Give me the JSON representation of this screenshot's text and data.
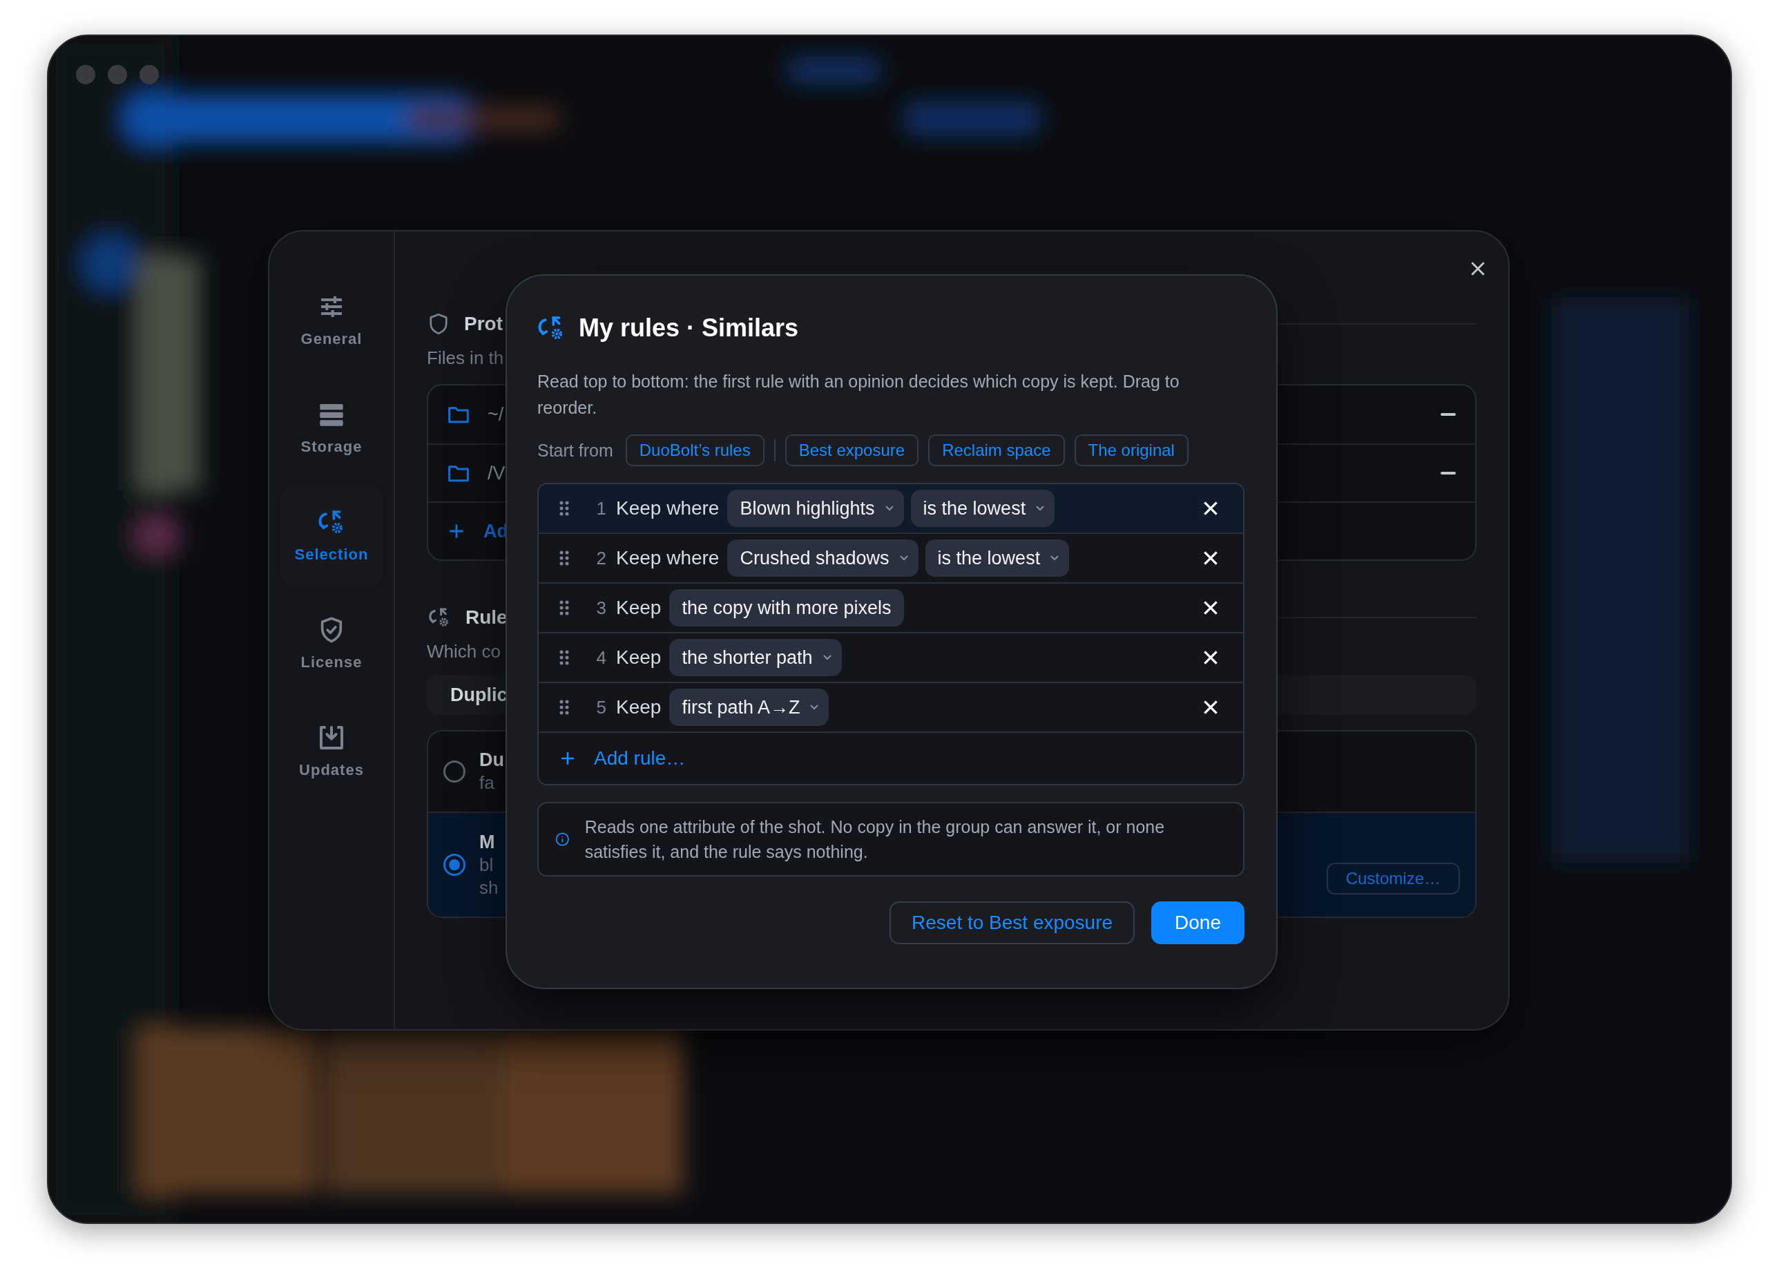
{
  "settings": {
    "sidebar": [
      {
        "label": "General",
        "kind": "sliders",
        "selected": false
      },
      {
        "label": "Storage",
        "kind": "storage",
        "selected": false
      },
      {
        "label": "Selection",
        "kind": "rules",
        "selected": true
      },
      {
        "label": "License",
        "kind": "shield",
        "selected": false
      },
      {
        "label": "Updates",
        "kind": "download",
        "selected": false
      }
    ],
    "protected": {
      "title": "Prot",
      "subtitle": "Files in th",
      "folders": [
        {
          "path": "~/"
        },
        {
          "path": "/V"
        }
      ],
      "add_label": "Ad"
    },
    "rules": {
      "title": "Rule",
      "subtitle": "Which co",
      "tabs": [
        {
          "label": "Duplic",
          "selected": true
        }
      ],
      "options": [
        {
          "title": "Du",
          "lines": [
            "fa"
          ],
          "selected": false
        },
        {
          "title": "M",
          "lines": [
            "bl",
            "sh"
          ],
          "selected": true,
          "button": "Customize…"
        }
      ]
    }
  },
  "modal": {
    "title": "My rules · Similars",
    "description": "Read top to bottom: the first rule with an opinion decides which copy is kept. Drag to reorder.",
    "start_from": {
      "label": "Start from",
      "presets": [
        "DuoBolt’s rules",
        "Best exposure",
        "Reclaim space",
        "The original"
      ]
    },
    "rules": [
      {
        "number": "1",
        "verb": "Keep where",
        "selected": true,
        "chips": [
          {
            "label": "Blown highlights",
            "dropdown": true
          },
          {
            "label": "is the lowest",
            "dropdown": true
          }
        ]
      },
      {
        "number": "2",
        "verb": "Keep where",
        "selected": false,
        "chips": [
          {
            "label": "Crushed shadows",
            "dropdown": true
          },
          {
            "label": "is the lowest",
            "dropdown": true
          }
        ]
      },
      {
        "number": "3",
        "verb": "Keep",
        "selected": false,
        "chips": [
          {
            "label": "the copy with more pixels",
            "dropdown": false
          }
        ]
      },
      {
        "number": "4",
        "verb": "Keep",
        "selected": false,
        "chips": [
          {
            "label": "the shorter path",
            "dropdown": true
          }
        ]
      },
      {
        "number": "5",
        "verb": "Keep",
        "selected": false,
        "chips": [
          {
            "label": "first path A→Z",
            "dropdown": true
          }
        ]
      }
    ],
    "add_rule": "Add rule…",
    "info": "Reads one attribute of the shot. No copy in the group can answer it, or none satisfies it, and the rule says nothing.",
    "buttons": [
      {
        "label": "Reset to Best exposure",
        "kind": "secondary"
      },
      {
        "label": "Done",
        "kind": "primary"
      }
    ]
  }
}
